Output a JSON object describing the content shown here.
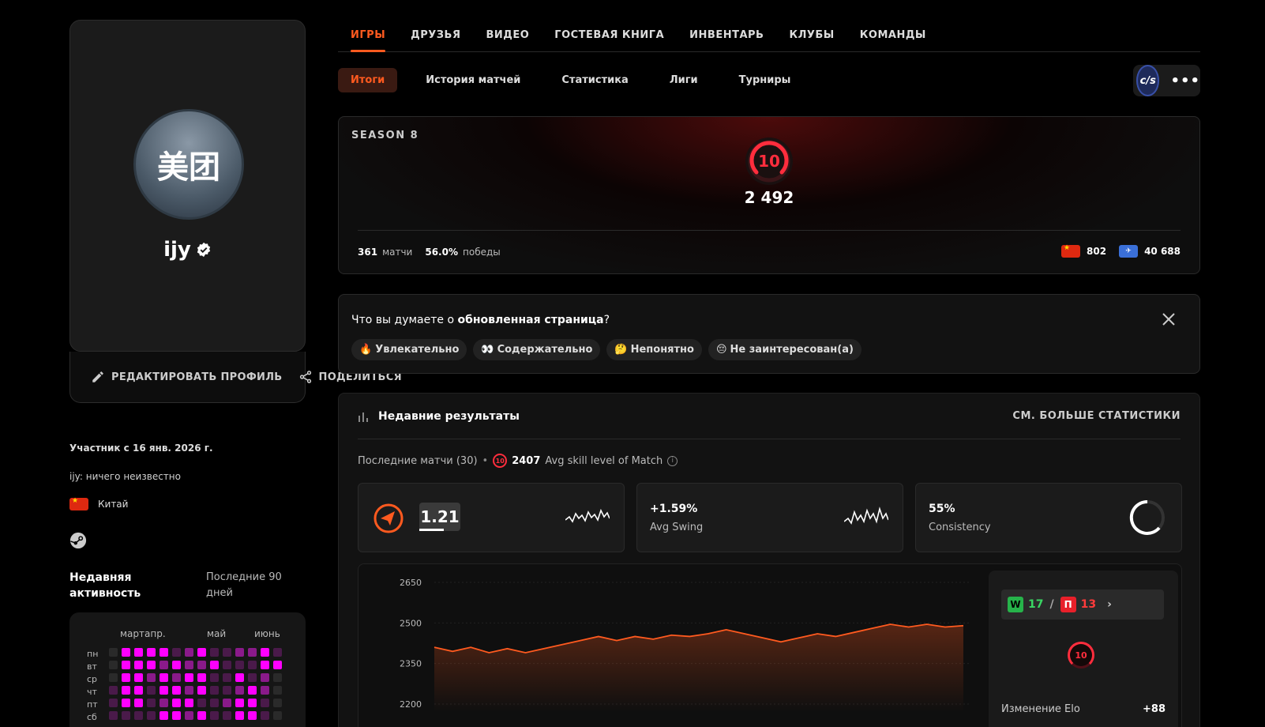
{
  "profile": {
    "avatar_text": "美团",
    "nickname": "ijy",
    "edit_label": "РЕДАКТИРОВАТЬ ПРОФИЛЬ",
    "share_label": "ПОДЕЛИТЬСЯ",
    "member_since": "Участник с 16 янв. 2026 г.",
    "bio": "ijy: ничего неизвестно",
    "country": "Китай"
  },
  "activity": {
    "title": "Недавняя активность",
    "range": "Последние 90 дней",
    "months": [
      "мартапр.",
      "май",
      "июнь"
    ],
    "days": [
      "пн",
      "вт",
      "ср",
      "чт",
      "пт",
      "сб"
    ],
    "rows": [
      [
        0,
        3,
        3,
        3,
        3,
        1,
        2,
        3,
        1,
        1,
        2,
        2,
        3,
        1
      ],
      [
        0,
        3,
        3,
        3,
        2,
        3,
        2,
        2,
        3,
        1,
        1,
        1,
        3,
        3
      ],
      [
        0,
        3,
        3,
        2,
        3,
        2,
        3,
        3,
        1,
        1,
        3,
        1,
        2,
        0
      ],
      [
        1,
        3,
        3,
        1,
        3,
        3,
        2,
        3,
        1,
        1,
        2,
        3,
        2,
        0
      ],
      [
        1,
        3,
        3,
        1,
        2,
        3,
        3,
        1,
        1,
        2,
        3,
        3,
        1,
        0
      ],
      [
        1,
        1,
        1,
        1,
        3,
        3,
        2,
        3,
        1,
        1,
        3,
        3,
        1,
        0
      ]
    ],
    "colors": [
      "#2a2a2a",
      "#4a1a4a",
      "#8a1a8a",
      "#ff00ff"
    ]
  },
  "tabs": [
    "ИГРЫ",
    "ДРУЗЬЯ",
    "ВИДЕО",
    "ГОСТЕВАЯ КНИГА",
    "ИНВЕНТАРЬ",
    "КЛУБЫ",
    "КОМАНДЫ"
  ],
  "subtabs": [
    "Итоги",
    "История матчей",
    "Статистика",
    "Лиги",
    "Турниры"
  ],
  "game": {
    "label": "c/s",
    "more": "•••"
  },
  "season": {
    "label": "SEASON 8",
    "level": "10",
    "elo": "2 492",
    "matches_value": "361",
    "matches_label": "матчи",
    "wins_value": "56.0%",
    "wins_label": "победы",
    "country_rank": "802",
    "region_rank": "40 688"
  },
  "feedback": {
    "question_prefix": "Что вы думаете о ",
    "question_bold": "обновленная страница",
    "question_suffix": "?",
    "options": [
      {
        "emoji": "🔥",
        "label": "Увлекательно"
      },
      {
        "emoji": "👀",
        "label": "Содержательно"
      },
      {
        "emoji": "🤔",
        "label": "Непонятно"
      },
      {
        "emoji": "😔",
        "label": "Не заинтересован(а)"
      }
    ]
  },
  "results": {
    "title": "Недавние результаты",
    "more_stats": "СМ. БОЛЬШЕ СТАТИСТИКИ",
    "last_matches": "Последние матчи (30)",
    "avg_skill_value": "2407",
    "avg_skill_label": "Avg skill level of Match",
    "rating": "1.21",
    "swing_value": "+1.59%",
    "swing_label": "Avg Swing",
    "consistency_value": "55%",
    "consistency_label": "Consistency",
    "wins": "17",
    "losses": "13",
    "w_tag": "W",
    "l_tag": "П",
    "sep": "/",
    "level": "10",
    "elo_change_label": "Изменение Elo",
    "elo_change_value": "+88",
    "colors": {
      "accent": "#ff5a1f",
      "win": "#26b34a",
      "loss": "#e8202a"
    }
  },
  "chart_data": {
    "type": "area",
    "y_ticks": [
      2650,
      2500,
      2350,
      2200
    ],
    "ylim": [
      2200,
      2650
    ],
    "x": [
      1,
      2,
      3,
      4,
      5,
      6,
      7,
      8,
      9,
      10,
      11,
      12,
      13,
      14,
      15,
      16,
      17,
      18,
      19,
      20,
      21,
      22,
      23,
      24,
      25,
      26,
      27,
      28,
      29,
      30
    ],
    "values": [
      2410,
      2395,
      2410,
      2390,
      2405,
      2390,
      2405,
      2420,
      2435,
      2450,
      2435,
      2450,
      2440,
      2455,
      2450,
      2460,
      2475,
      2460,
      2445,
      2430,
      2445,
      2460,
      2450,
      2465,
      2480,
      2495,
      2485,
      2495,
      2485,
      2490
    ]
  }
}
